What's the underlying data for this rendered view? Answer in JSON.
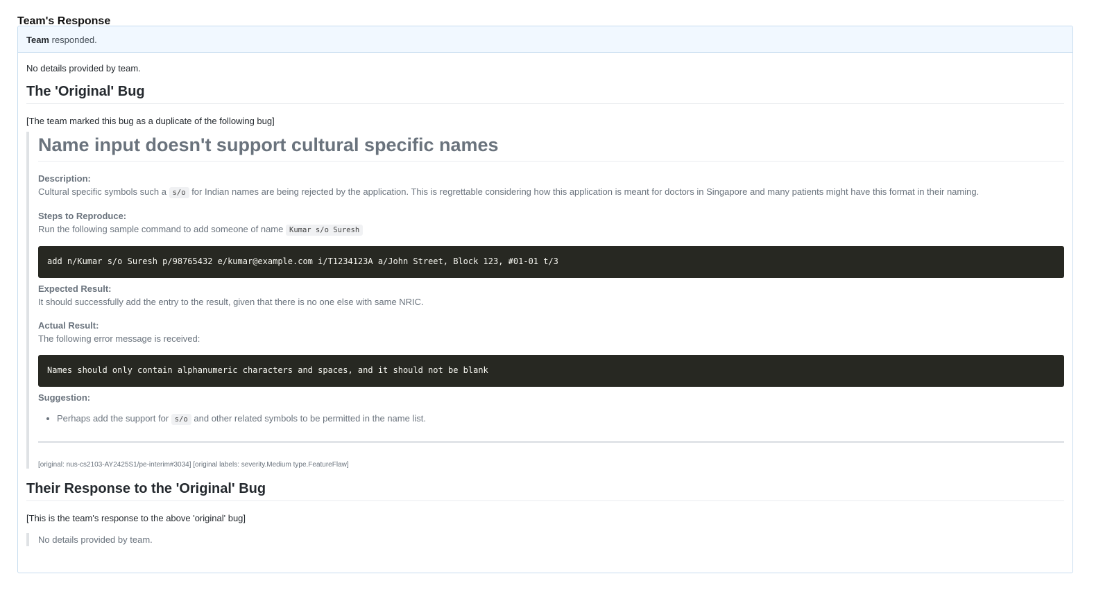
{
  "section_title": "Team's Response",
  "header": {
    "actor": "Team",
    "action": "responded."
  },
  "no_details": "No details provided by team.",
  "original_bug": {
    "heading": "The 'Original' Bug",
    "dup_note": "[The team marked this bug as a duplicate of the following bug]",
    "title": "Name input doesn't support cultural specific names",
    "description_label": "Description:",
    "description_pre": "Cultural specific symbols such a",
    "description_code": "s/o",
    "description_post": "for Indian names are being rejected by the application. This is regrettable considering how this application is meant for doctors in Singapore and many patients might have this format in their naming.",
    "steps_label": "Steps to Reproduce:",
    "steps_pre": "Run the following sample command to add someone of name",
    "steps_code": "Kumar s/o Suresh",
    "steps_command": "add n/Kumar s/o Suresh p/98765432 e/kumar@example.com i/T1234123A a/John Street, Block 123, #01-01 t/3",
    "expected_label": "Expected Result:",
    "expected_text": "It should successfully add the entry to the result, given that there is no one else with same NRIC.",
    "actual_label": "Actual Result:",
    "actual_text": "The following error message is received:",
    "actual_error": "Names should only contain alphanumeric characters and spaces, and it should not be blank",
    "suggestion_label": "Suggestion:",
    "suggestion_pre": "Perhaps add the support for",
    "suggestion_code": "s/o",
    "suggestion_post": "and other related symbols to be permitted in the name list.",
    "origin": "[original: nus-cs2103-AY2425S1/pe-interim#3034] [original labels: severity.Medium type.FeatureFlaw]"
  },
  "their_response": {
    "heading": "Their Response to the 'Original' Bug",
    "note": "[This is the team's response to the above 'original' bug]",
    "quote": "No details provided by team."
  }
}
